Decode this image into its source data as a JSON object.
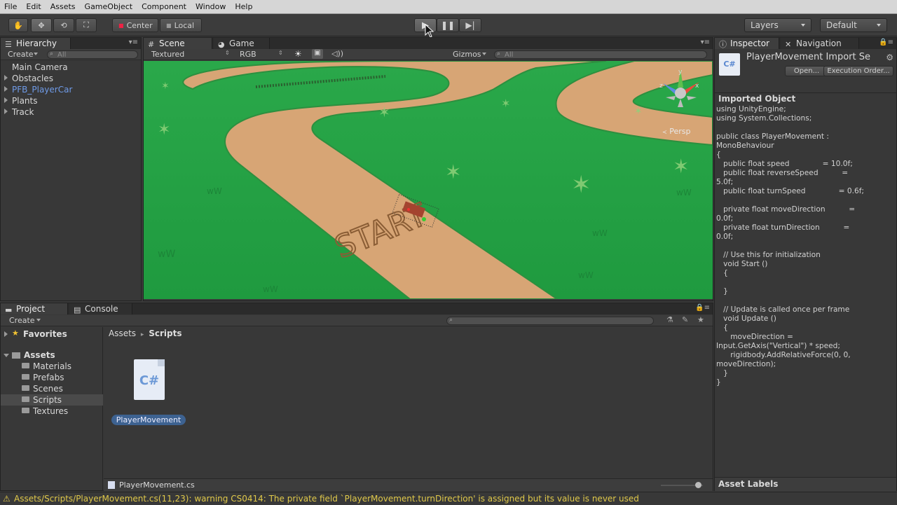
{
  "menu": [
    "File",
    "Edit",
    "Assets",
    "GameObject",
    "Component",
    "Window",
    "Help"
  ],
  "toolbar": {
    "pivot": "Center",
    "space": "Local",
    "layers": "Layers",
    "layout": "Default"
  },
  "hierarchy": {
    "tab": "Hierarchy",
    "create": "Create",
    "search_placeholder": "All",
    "items": [
      "Main Camera",
      "Obstacles",
      "PFB_PlayerCar",
      "Plants",
      "Track"
    ]
  },
  "scene": {
    "tab_scene": "Scene",
    "tab_game": "Game",
    "render_mode": "Textured",
    "channel": "RGB",
    "gizmos": "Gizmos",
    "search_placeholder": "All",
    "persp": "Persp",
    "start_text": "START",
    "gizmo_y": "y",
    "gizmo_x": "x",
    "gizmo_z": "z"
  },
  "project": {
    "tab_project": "Project",
    "tab_console": "Console",
    "create": "Create",
    "favorites": "Favorites",
    "assets": "Assets",
    "folders": [
      "Materials",
      "Prefabs",
      "Scenes",
      "Scripts",
      "Textures"
    ],
    "selected_folder": "Scripts",
    "breadcrumb_root": "Assets",
    "breadcrumb_current": "Scripts",
    "asset_name": "PlayerMovement",
    "asset_icon_text": "C#",
    "selected_file": "PlayerMovement.cs"
  },
  "inspector": {
    "tab_inspector": "Inspector",
    "tab_navigation": "Navigation",
    "title": "PlayerMovement Import Se",
    "open": "Open...",
    "execution_order": "Execution Order...",
    "imported_object": "Imported Object",
    "code": "using UnityEngine;\nusing System.Collections;\n\npublic class PlayerMovement :\nMonoBehaviour\n{\n   public float speed              = 10.0f;\n   public float reverseSpeed          =\n5.0f;\n   public float turnSpeed              = 0.6f;\n\n   private float moveDirection          =\n0.0f;\n   private float turnDirection          =\n0.0f;\n\n   // Use this for initialization\n   void Start ()\n   {\n\n   }\n\n   // Update is called once per frame\n   void Update ()\n   {\n      moveDirection =\nInput.GetAxis(\"Vertical\") * speed;\n      rigidbody.AddRelativeForce(0, 0,\nmoveDirection);\n   }\n}",
    "asset_labels": "Asset Labels"
  },
  "status": {
    "message": "Assets/Scripts/PlayerMovement.cs(11,23): warning CS0414: The private field `PlayerMovement.turnDirection' is assigned but its value is never used"
  },
  "colors": {
    "grass": "#26a346",
    "track": "#d7a575",
    "selection": "#3d6291",
    "warning": "#e0c94a"
  }
}
